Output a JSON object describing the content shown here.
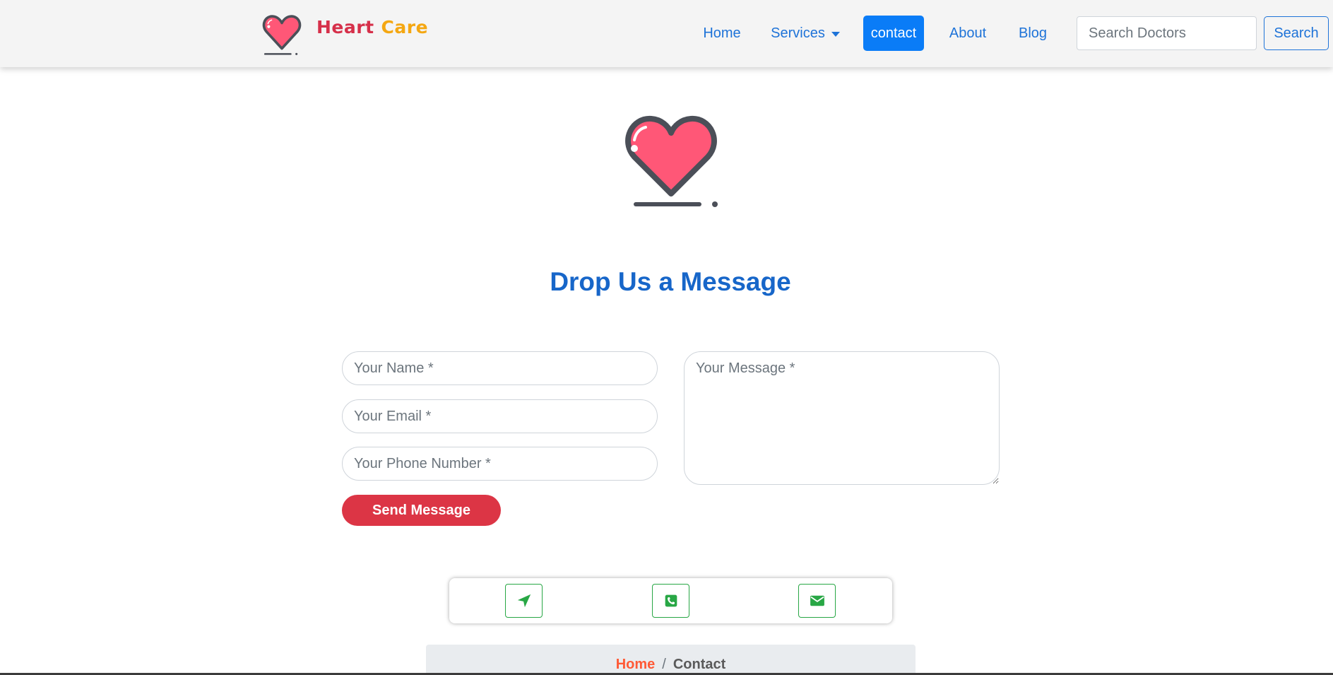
{
  "brand": {
    "word1": "Heart",
    "word2": "Care"
  },
  "nav": {
    "home": "Home",
    "services": "Services",
    "contact": "contact",
    "about": "About",
    "blog": "Blog"
  },
  "search": {
    "placeholder": "Search Doctors",
    "button": "Search"
  },
  "section": {
    "title": "Drop Us a Message"
  },
  "form": {
    "name_placeholder": "Your Name *",
    "email_placeholder": "Your Email *",
    "phone_placeholder": "Your Phone Number *",
    "message_placeholder": "Your Message *",
    "send_label": "Send Message"
  },
  "contact_icons": [
    "location-arrow-icon",
    "phone-icon",
    "envelope-icon"
  ],
  "breadcrumb": {
    "home": "Home",
    "separator": "/",
    "current": "Contact"
  },
  "colors": {
    "primary": "#0a7cf7",
    "link": "#1e73d8",
    "danger": "#dc3545",
    "success": "#28a745",
    "brand_red": "#d6304a",
    "brand_yellow": "#f4a712",
    "heart_pink": "#ff5777"
  }
}
